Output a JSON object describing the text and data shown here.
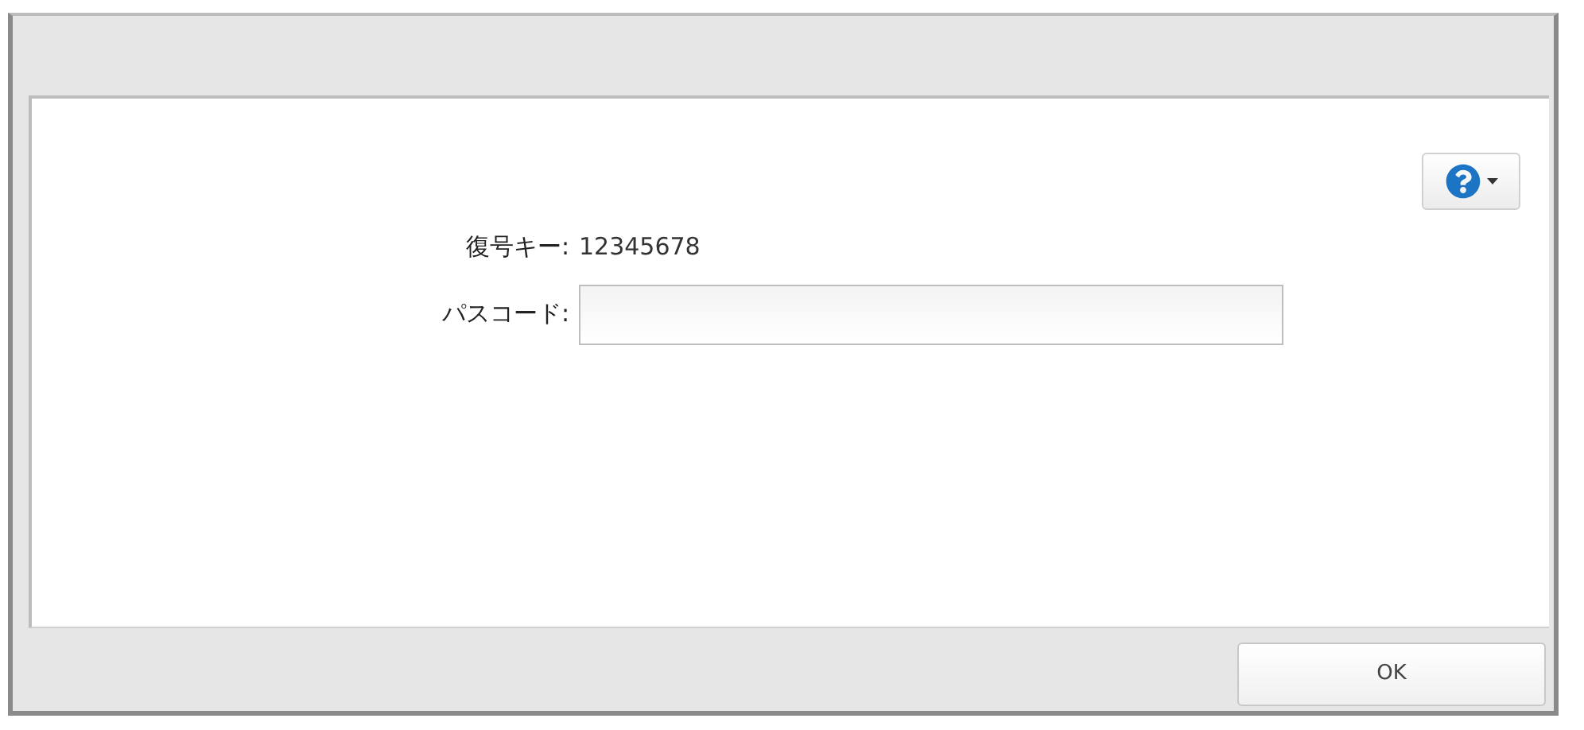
{
  "key_row": {
    "label": "復号キー:",
    "value": "12345678"
  },
  "passcode": {
    "label": "パスコード:"
  },
  "buttons": [
    {
      "label": "OK"
    }
  ]
}
